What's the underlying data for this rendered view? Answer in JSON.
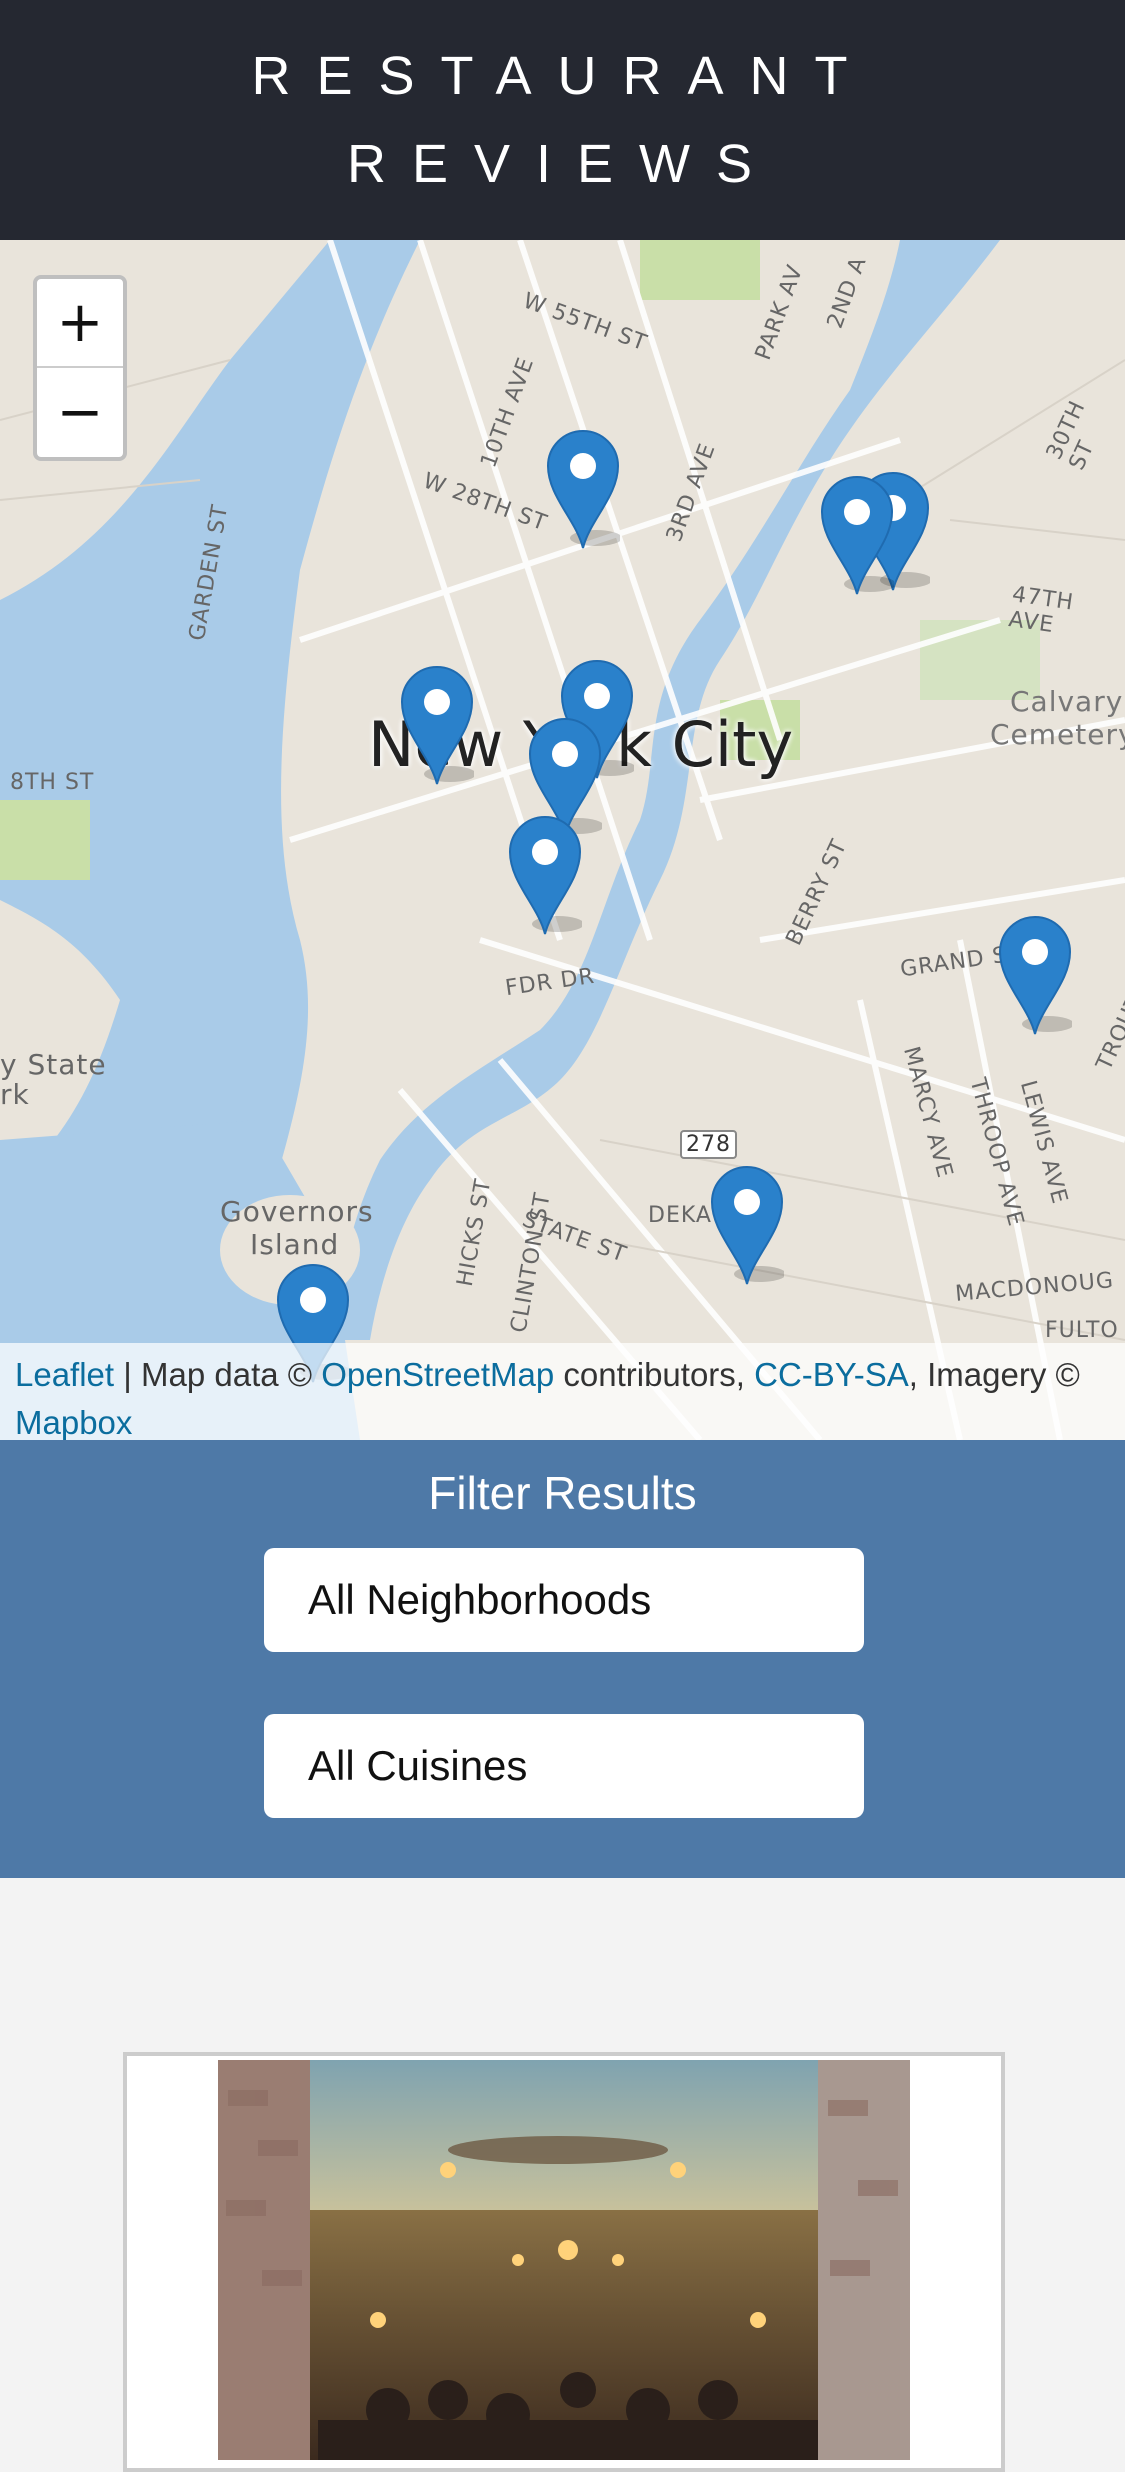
{
  "header": {
    "title": "RESTAURANT REVIEWS"
  },
  "map": {
    "city_label": "New York City",
    "zoom_in_label": "+",
    "zoom_out_label": "−",
    "street_labels": [
      "W 55TH ST",
      "10TH AVE",
      "W 28TH ST",
      "3RD AVE",
      "PARK AV",
      "2ND A",
      "GARDEN ST",
      "8TH ST",
      "FDR DR",
      "BERRY ST",
      "GRAND S",
      "47TH AVE",
      "30TH ST",
      "Calvary",
      "Cemetery",
      "HICKS ST",
      "CLINTON ST",
      "STATE ST",
      "DEKA",
      "MARCY AVE",
      "THROOP AVE",
      "LEWIS AVE",
      "MACDONOUG",
      "FULTO",
      "TROUT",
      "Governors",
      "Island",
      "y State",
      "rk",
      "278"
    ],
    "marker_count": 10,
    "colors": {
      "water": "#a9cbe8",
      "land": "#e9e4db",
      "park": "#c9dfa8",
      "marker": "#2a81cb"
    }
  },
  "attribution": {
    "leaflet": "Leaflet",
    "sep": " | Map data © ",
    "osm": "OpenStreetMap",
    "contributors": " contributors, ",
    "license": "CC-BY-SA",
    "imagery": ", Imagery © ",
    "mapbox": "Mapbox"
  },
  "filter": {
    "title": "Filter Results",
    "neighborhood_selected": "All Neighborhoods",
    "cuisine_selected": "All Cuisines"
  },
  "restaurants": [
    {
      "image_alt": "restaurant dining room photo"
    }
  ]
}
